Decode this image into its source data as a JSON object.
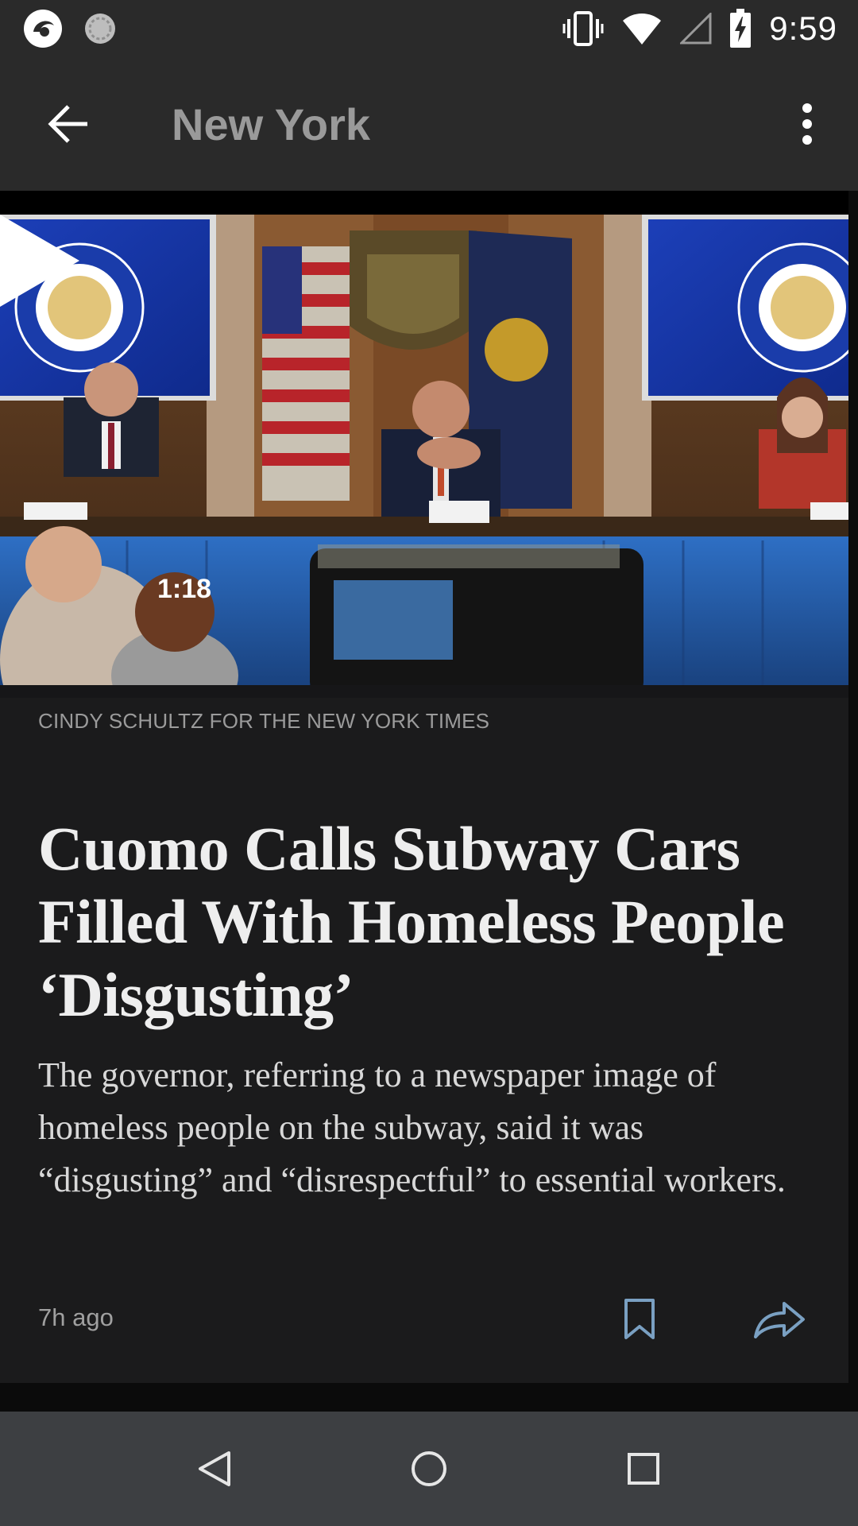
{
  "status_bar": {
    "time": "9:59",
    "left_icons": [
      "app-notification-icon",
      "sync-icon"
    ],
    "right_icons": [
      "vibrate-icon",
      "wifi-icon",
      "cell-signal-icon",
      "battery-charging-icon"
    ]
  },
  "app_bar": {
    "title": "New York",
    "back_icon": "arrow-back-icon",
    "menu_icon": "more-vert-icon"
  },
  "article": {
    "video_duration": "1:18",
    "photo_credit": "CINDY SCHULTZ FOR THE NEW YORK TIMES",
    "headline": "Cuomo Calls Subway Cars Filled With Homeless People ‘Disgusting’",
    "summary": "The governor, referring to a newspaper image of homeless people on the subway, said it was “disgusting” and “disrespectful” to essential workers.",
    "timestamp": "7h ago",
    "bookmark_icon": "bookmark-icon",
    "share_icon": "share-icon"
  },
  "nav_bar": {
    "buttons": [
      "back-triangle-icon",
      "home-circle-icon",
      "recents-square-icon"
    ]
  },
  "colors": {
    "bars": "#2a2a2a",
    "card": "#1b1b1c",
    "nav": "#3d3f42",
    "accent_icons": "#7aa0c2"
  }
}
